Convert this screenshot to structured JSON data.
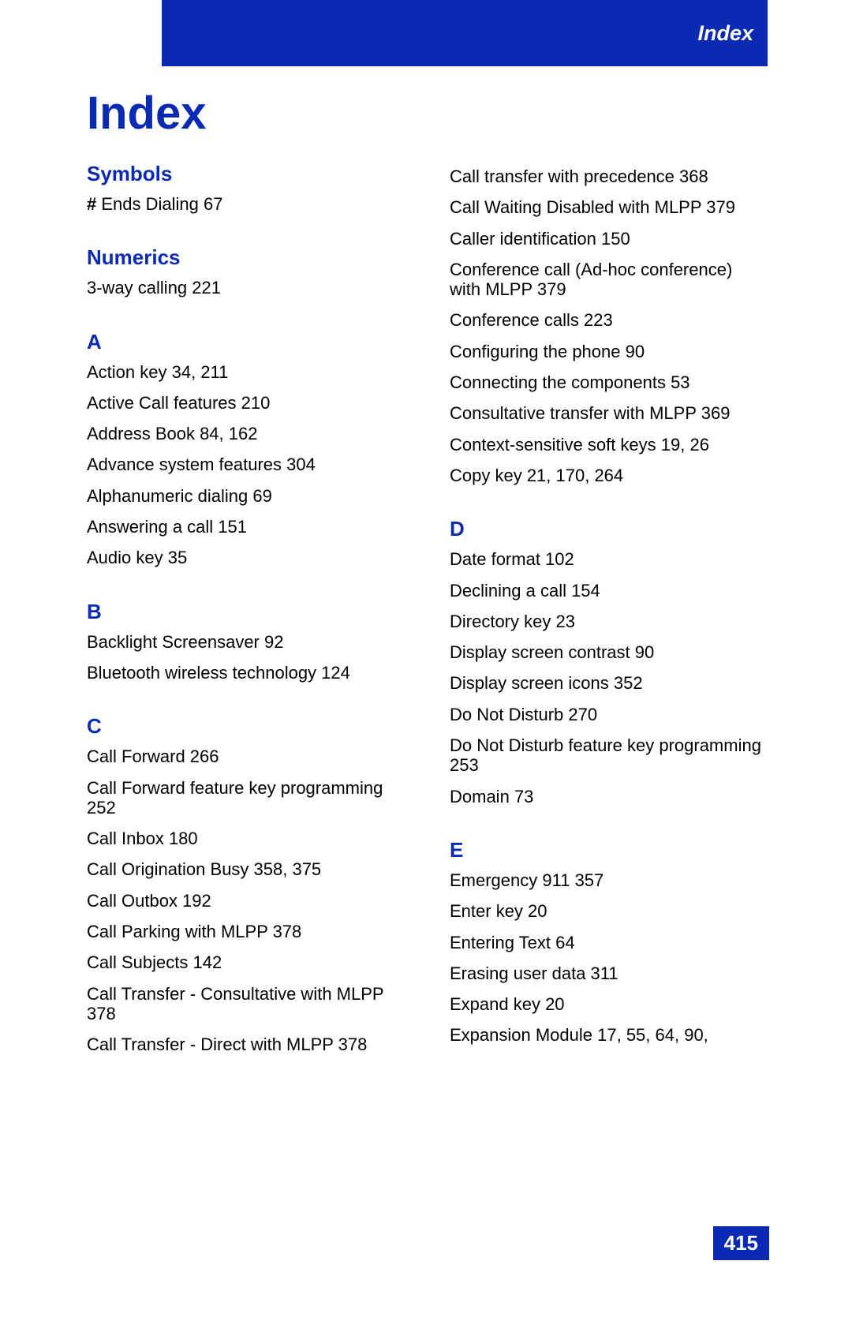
{
  "banner": {
    "label": "Index"
  },
  "title": "Index",
  "pageNumber": "415",
  "left": {
    "symbols": {
      "heading": "Symbols",
      "entries": [
        {
          "prefix": "# ",
          "text": "Ends Dialing 67"
        }
      ]
    },
    "numerics": {
      "heading": "Numerics",
      "entries": [
        {
          "text": "3-way calling 221"
        }
      ]
    },
    "A": {
      "heading": "A",
      "entries": [
        {
          "text": "Action key 34, 211"
        },
        {
          "text": "Active Call features 210"
        },
        {
          "text": "Address Book 84, 162"
        },
        {
          "text": "Advance system features 304"
        },
        {
          "text": "Alphanumeric dialing 69"
        },
        {
          "text": "Answering a call 151"
        },
        {
          "text": "Audio key 35"
        }
      ]
    },
    "B": {
      "heading": "B",
      "entries": [
        {
          "text": "Backlight Screensaver 92"
        },
        {
          "text": "Bluetooth wireless technology 124"
        }
      ]
    },
    "C": {
      "heading": "C",
      "entries": [
        {
          "text": "Call Forward 266"
        },
        {
          "text": "Call Forward feature key programming 252"
        },
        {
          "text": "Call Inbox 180"
        },
        {
          "text": "Call Origination Busy 358, 375"
        },
        {
          "text": "Call Outbox 192"
        },
        {
          "text": "Call Parking with MLPP 378"
        },
        {
          "text": "Call Subjects 142"
        },
        {
          "text": "Call Transfer - Consultative with MLPP 378"
        },
        {
          "text": "Call Transfer - Direct with MLPP 378"
        }
      ]
    }
  },
  "right": {
    "continuationC": [
      {
        "text": "Call transfer with precedence 368"
      },
      {
        "text": "Call Waiting Disabled with MLPP 379"
      },
      {
        "text": "Caller identification 150"
      },
      {
        "text": "Conference call (Ad-hoc conference) with MLPP 379"
      },
      {
        "text": "Conference calls 223"
      },
      {
        "text": "Configuring the phone 90"
      },
      {
        "text": "Connecting the components 53"
      },
      {
        "text": "Consultative transfer with MLPP 369"
      },
      {
        "text": "Context-sensitive soft keys 19, 26"
      },
      {
        "text": "Copy key 21, 170, 264"
      }
    ],
    "D": {
      "heading": "D",
      "entries": [
        {
          "text": "Date format 102"
        },
        {
          "text": "Declining a call 154"
        },
        {
          "text": "Directory key 23"
        },
        {
          "text": "Display screen contrast 90"
        },
        {
          "text": "Display screen icons 352"
        },
        {
          "text": "Do Not Disturb 270"
        },
        {
          "text": "Do Not Disturb feature key programming 253"
        },
        {
          "text": "Domain 73"
        }
      ]
    },
    "E": {
      "heading": "E",
      "entries": [
        {
          "text": "Emergency 911 357"
        },
        {
          "text": "Enter key 20"
        },
        {
          "text": "Entering Text 64"
        },
        {
          "text": "Erasing user data 311"
        },
        {
          "text": "Expand key 20"
        },
        {
          "text": "Expansion Module 17, 55, 64, 90,"
        }
      ]
    }
  }
}
